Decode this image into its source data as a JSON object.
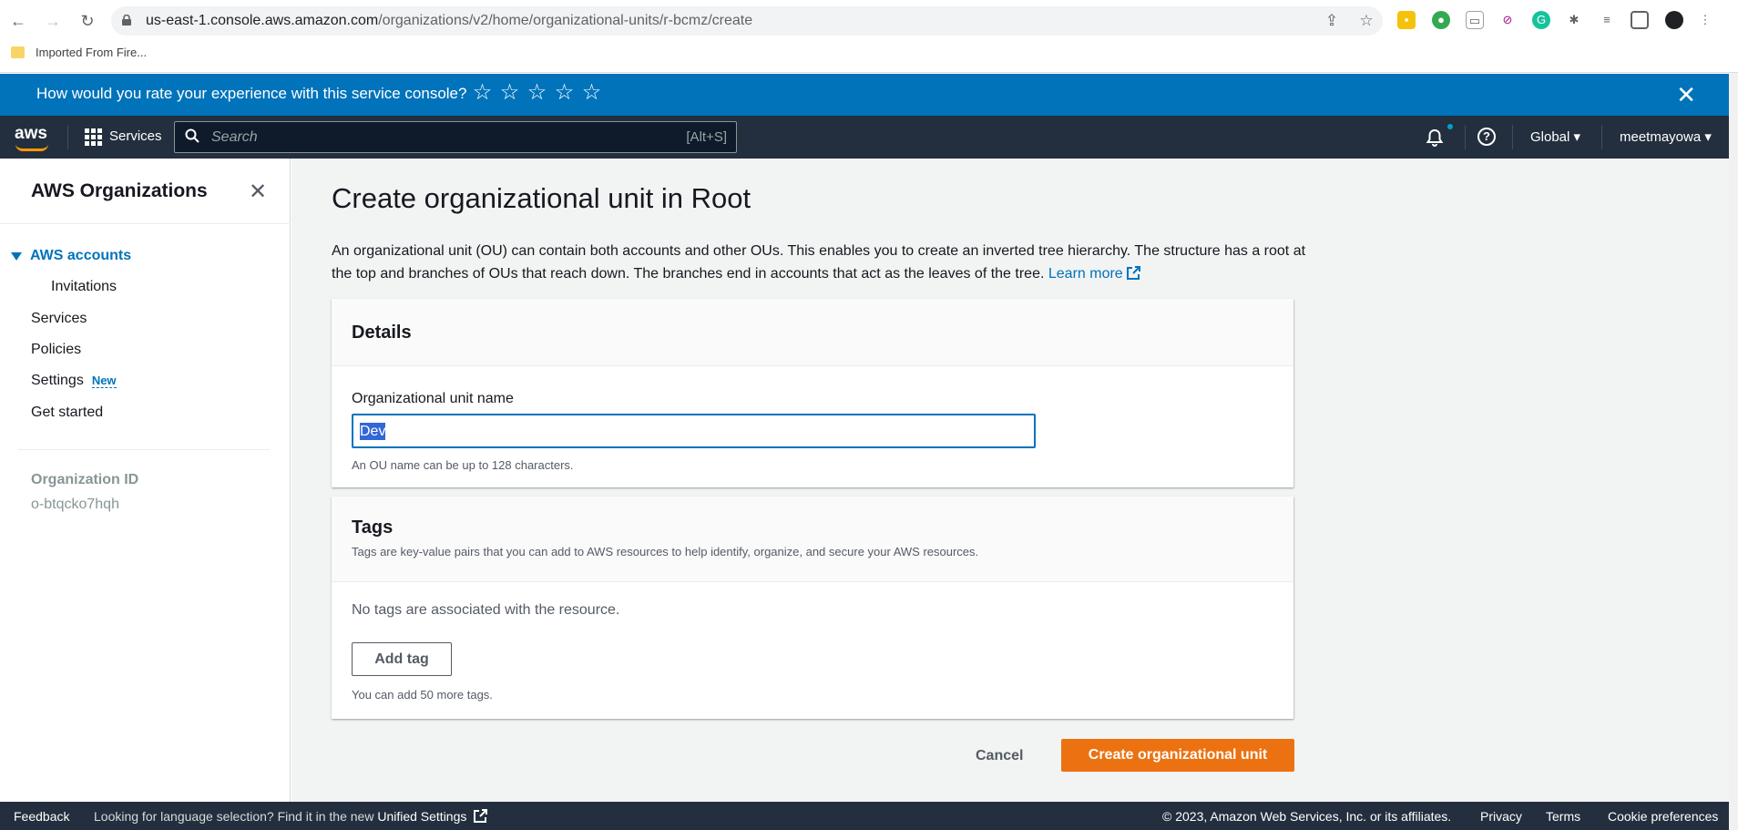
{
  "browser": {
    "url_host": "us-east-1.console.aws.amazon.com",
    "url_path": "/organizations/v2/home/organizational-units/r-bcmz/create",
    "bookmark": "Imported From Fire..."
  },
  "banner": {
    "question": "How would you rate your experience with this service console?",
    "stars": [
      "☆",
      "☆",
      "☆",
      "☆",
      "☆"
    ],
    "close": "✕"
  },
  "topnav": {
    "logo": "aws",
    "services": "Services",
    "search_placeholder": "Search",
    "search_shortcut": "[Alt+S]",
    "help": "?",
    "region": "Global ▾",
    "user": "meetmayowa ▾"
  },
  "sidebar": {
    "title": "AWS Organizations",
    "close": "✕",
    "items": [
      {
        "label": "AWS accounts"
      },
      {
        "label": "Invitations"
      },
      {
        "label": "Services"
      },
      {
        "label": "Policies"
      },
      {
        "label": "Settings",
        "badge": "New"
      },
      {
        "label": "Get started"
      }
    ],
    "org_id_label": "Organization ID",
    "org_id_value": "o-btqcko7hqh"
  },
  "main": {
    "title": "Create organizational unit in Root",
    "description": "An organizational unit (OU) can contain both accounts and other OUs. This enables you to create an inverted tree hierarchy. The structure has a root at the top and branches of OUs that reach down. The branches end in accounts that act as the leaves of the tree.",
    "learn_more": "Learn more",
    "details": {
      "heading": "Details",
      "field_label": "Organizational unit name",
      "field_value": "Dev",
      "constraint": "An OU name can be up to 128 characters."
    },
    "tags": {
      "heading": "Tags",
      "description": "Tags are key-value pairs that you can add to AWS resources to help identify, organize, and secure your AWS resources.",
      "empty": "No tags are associated with the resource.",
      "add_button": "Add tag",
      "limit": "You can add 50 more tags."
    },
    "cancel": "Cancel",
    "create": "Create organizational unit"
  },
  "footer": {
    "feedback": "Feedback",
    "language_prompt": "Looking for language selection? Find it in the new",
    "unified_settings": "Unified Settings",
    "copyright": "© 2023, Amazon Web Services, Inc. or its affiliates.",
    "privacy": "Privacy",
    "terms": "Terms",
    "cookies": "Cookie preferences"
  },
  "colors": {
    "banner": "#0073bb",
    "nav": "#232f3e",
    "accent": "#0073bb",
    "primary_button": "#ec7211"
  }
}
